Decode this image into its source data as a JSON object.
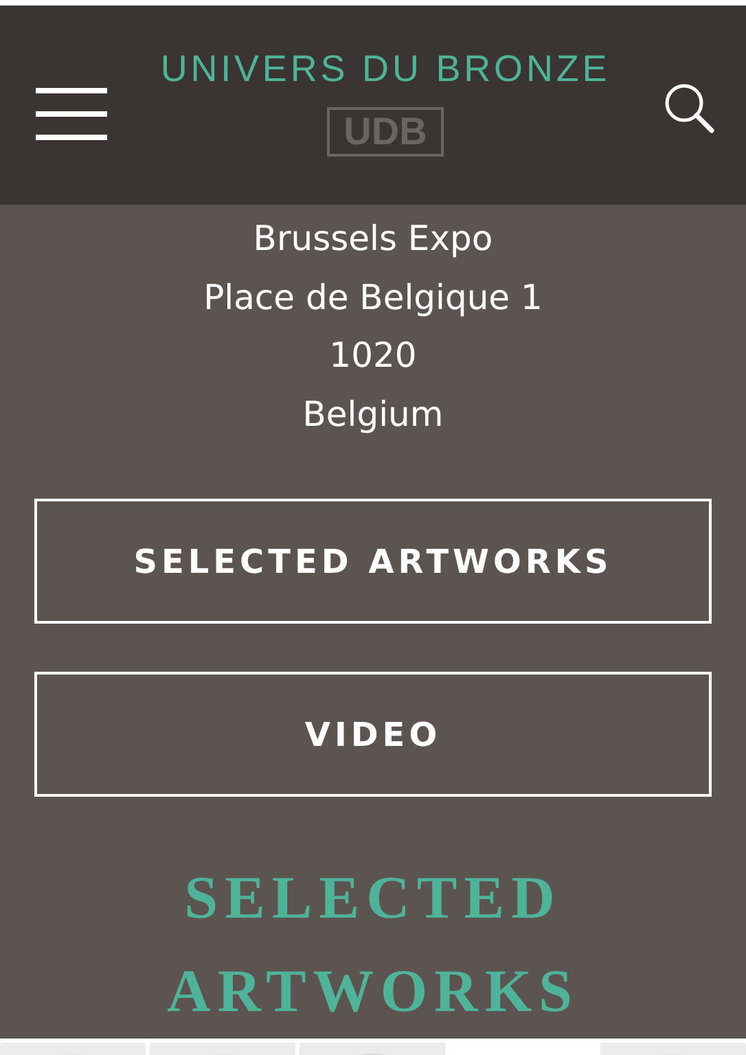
{
  "header": {
    "site_title": "UNIVERS DU BRONZE",
    "logo_text": "UDB"
  },
  "address": [
    "Brussels Expo",
    "Place de Belgique 1",
    "1020",
    "Belgium"
  ],
  "buttons": [
    "SELECTED ARTWORKS",
    "VIDEO"
  ],
  "section_heading": "SELECTED ARTWORKS",
  "cards": [
    {
      "kind": "picture"
    },
    {
      "kind": "picture"
    },
    {
      "kind": "picture"
    },
    {
      "kind": "blank"
    },
    {
      "kind": "picture"
    }
  ]
}
